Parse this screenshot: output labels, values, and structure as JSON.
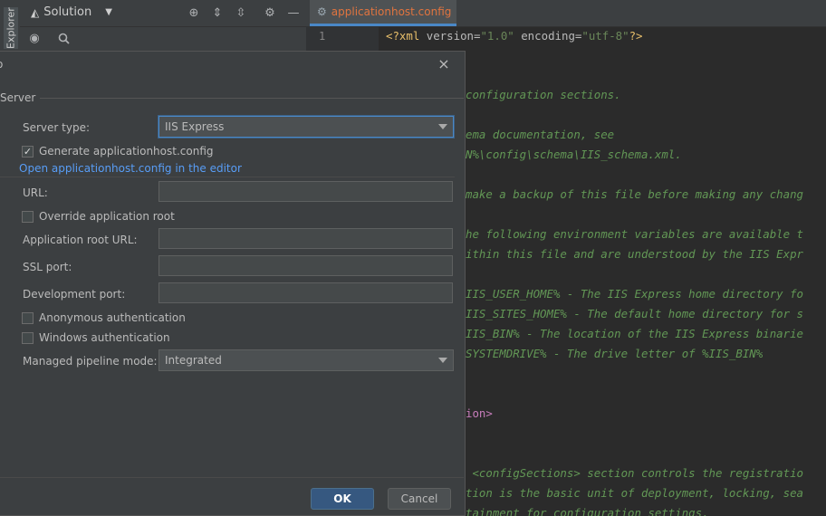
{
  "explorer": {
    "side_tab_label": "Explorer",
    "solution_selector": "Solution"
  },
  "editor": {
    "tab_label": "applicationhost.config",
    "line_number": "1",
    "lines": [
      "configuration sections.",
      "ema documentation, see",
      "N%\\config\\schema\\IIS_schema.xml.",
      "make a backup of this file before making any chang",
      "he following environment variables are available t",
      "ithin this file and are understood by the IIS Expr",
      "IIS_USER_HOME% - The IIS Express home directory fo",
      "IIS_SITES_HOME% - The default home directory for s",
      "IIS_BIN% - The location of the IIS Express binarie",
      "SYSTEMDRIVE% - The drive letter of %IIS_BIN%",
      "ion>",
      " <configSections> section controls the registratio",
      "tion is the basic unit of deployment, locking, sea",
      "tainment for configuration settings."
    ],
    "line1": {
      "open": "<?xml ",
      "attr1": "version=",
      "val1": "\"1.0\"",
      "attr2": " encoding=",
      "val2": "\"utf-8\"",
      "close": "?>"
    }
  },
  "dialog": {
    "title": "o",
    "group_label": "Server",
    "server_type_label": "Server type:",
    "server_type_value": "IIS Express",
    "generate_config_label": "Generate applicationhost.config",
    "generate_config_checked": true,
    "open_config_link": "Open applicationhost.config in the editor",
    "url_label": "URL:",
    "url_value": "",
    "override_root_label": "Override application root",
    "override_root_checked": false,
    "app_root_url_label": "Application root URL:",
    "app_root_url_value": "",
    "ssl_port_label": "SSL port:",
    "ssl_port_value": "",
    "dev_port_label": "Development port:",
    "dev_port_value": "",
    "anon_auth_label": "Anonymous authentication",
    "anon_auth_checked": false,
    "windows_auth_label": "Windows authentication",
    "windows_auth_checked": false,
    "pipeline_mode_label": "Managed pipeline mode:",
    "pipeline_mode_value": "Integrated",
    "ok_label": "OK",
    "cancel_label": "Cancel",
    "close_glyph": "×"
  },
  "colors": {
    "accent": "#4a88c7",
    "link": "#589df6",
    "ok_button": "#365880",
    "tab_text": "#e0743f",
    "comment": "#629755"
  }
}
